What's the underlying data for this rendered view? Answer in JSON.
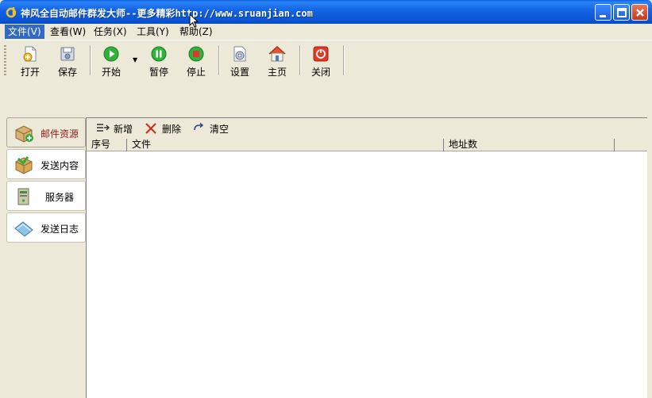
{
  "window": {
    "title": "神风全自动邮件群发大师--更多精彩http://www.sruanjian.com"
  },
  "menu": [
    {
      "label": "文件(V)",
      "active": true
    },
    {
      "label": "查看(W)"
    },
    {
      "label": "任务(X)"
    },
    {
      "label": "工具(Y)"
    },
    {
      "label": "帮助(Z)"
    }
  ],
  "toolbar": {
    "open": "打开",
    "save": "保存",
    "start": "开始",
    "pause": "暂停",
    "stop": "停止",
    "settings": "设置",
    "home": "主页",
    "close": "关闭"
  },
  "nav": [
    {
      "label": "邮件资源",
      "icon": "mail-resource-icon",
      "active": true
    },
    {
      "label": "发送内容",
      "icon": "send-content-icon"
    },
    {
      "label": "服务器",
      "icon": "server-icon"
    },
    {
      "label": "发送日志",
      "icon": "send-log-icon"
    }
  ],
  "subtoolbar": {
    "add": "新增",
    "delete": "删除",
    "clear": "清空"
  },
  "grid": {
    "columns": [
      "序号",
      "文件",
      "地址数"
    ]
  },
  "colors": {
    "titlebar": "#0b54d4",
    "menu_active": "#316ac5",
    "active_nav_text": "#8b1a1a"
  }
}
